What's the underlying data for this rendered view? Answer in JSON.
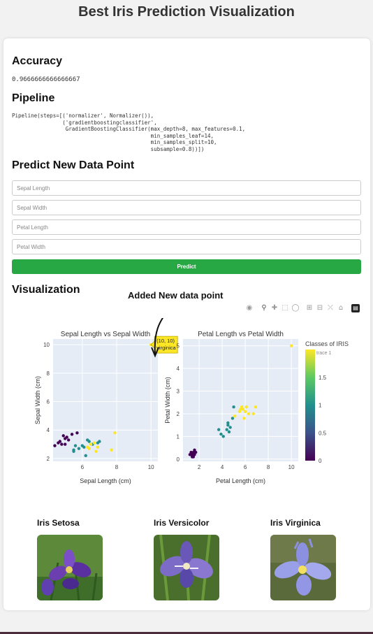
{
  "page_title": "Best Iris Prediction Visualization",
  "accuracy": {
    "heading": "Accuracy",
    "value": "0.9666666666666667"
  },
  "pipeline": {
    "heading": "Pipeline",
    "text": "Pipeline(steps=[('normalizer', Normalizer()),\n                ('gradientboostingclassifier',\n                 GradientBoostingClassifier(max_depth=8, max_features=0.1,\n                                            min_samples_leaf=14,\n                                            min_samples_split=10,\n                                            subsample=0.8))])"
  },
  "predict": {
    "heading": "Predict New Data Point",
    "fields": [
      {
        "placeholder": "Sepal Length"
      },
      {
        "placeholder": "Sepal Width"
      },
      {
        "placeholder": "Petal Length"
      },
      {
        "placeholder": "Petal Width"
      }
    ],
    "button_label": "Predict"
  },
  "visualization": {
    "heading": "Visualization",
    "annotation": "Added New data point",
    "modebar_icons": [
      "camera-icon",
      "zoom-icon",
      "pan-icon",
      "box-select-icon",
      "lasso-icon",
      "zoom-in-icon",
      "zoom-out-icon",
      "autoscale-icon",
      "reset-axes-icon",
      "plotly-logo-icon"
    ]
  },
  "chart_data": [
    {
      "type": "scatter",
      "title": "Sepal Length vs Sepal Width",
      "xlabel": "Sepal Length (cm)",
      "ylabel": "Sepal Width (cm)",
      "xlim": [
        4.3,
        10.4
      ],
      "ylim": [
        1.8,
        10.4
      ],
      "xticks": [
        6,
        8,
        10
      ],
      "yticks": [
        2,
        4,
        6,
        8,
        10
      ],
      "grid": true,
      "tooltip": {
        "x": 10,
        "y": 10,
        "lines": [
          "(10, 10)",
          "virginica"
        ]
      },
      "points": [
        {
          "x": 4.6,
          "y": 3.1,
          "c": 0
        },
        {
          "x": 4.7,
          "y": 3.2,
          "c": 0
        },
        {
          "x": 4.8,
          "y": 3.0,
          "c": 0
        },
        {
          "x": 4.9,
          "y": 3.6,
          "c": 0
        },
        {
          "x": 5.0,
          "y": 3.4,
          "c": 0
        },
        {
          "x": 5.1,
          "y": 3.5,
          "c": 0
        },
        {
          "x": 5.2,
          "y": 3.3,
          "c": 0
        },
        {
          "x": 5.4,
          "y": 3.7,
          "c": 0
        },
        {
          "x": 5.0,
          "y": 3.0,
          "c": 0
        },
        {
          "x": 5.7,
          "y": 3.8,
          "c": 0
        },
        {
          "x": 4.4,
          "y": 2.9,
          "c": 0
        },
        {
          "x": 5.5,
          "y": 2.5,
          "c": 1
        },
        {
          "x": 5.6,
          "y": 2.9,
          "c": 1
        },
        {
          "x": 5.8,
          "y": 2.7,
          "c": 1
        },
        {
          "x": 6.0,
          "y": 2.9,
          "c": 1
        },
        {
          "x": 6.1,
          "y": 2.8,
          "c": 1
        },
        {
          "x": 6.2,
          "y": 2.2,
          "c": 1
        },
        {
          "x": 6.4,
          "y": 3.2,
          "c": 1
        },
        {
          "x": 6.6,
          "y": 3.0,
          "c": 1
        },
        {
          "x": 6.9,
          "y": 3.1,
          "c": 1
        },
        {
          "x": 7.0,
          "y": 3.2,
          "c": 1
        },
        {
          "x": 5.5,
          "y": 2.6,
          "c": 1
        },
        {
          "x": 6.3,
          "y": 3.3,
          "c": 1
        },
        {
          "x": 6.3,
          "y": 2.8,
          "c": 2
        },
        {
          "x": 6.5,
          "y": 3.0,
          "c": 2
        },
        {
          "x": 6.7,
          "y": 3.1,
          "c": 2
        },
        {
          "x": 6.9,
          "y": 2.8,
          "c": 2
        },
        {
          "x": 7.7,
          "y": 2.6,
          "c": 2
        },
        {
          "x": 7.9,
          "y": 3.8,
          "c": 2
        },
        {
          "x": 6.8,
          "y": 2.5,
          "c": 2
        },
        {
          "x": 6.4,
          "y": 2.7,
          "c": 2
        },
        {
          "x": 10,
          "y": 10,
          "c": 2
        }
      ]
    },
    {
      "type": "scatter",
      "title": "Petal Length vs Petal Width",
      "xlabel": "Petal Length (cm)",
      "ylabel": "Petal Width (cm)",
      "xlim": [
        0.6,
        10.6
      ],
      "ylim": [
        -0.1,
        5.3
      ],
      "xticks": [
        2,
        4,
        6,
        8,
        10
      ],
      "yticks": [
        0,
        1,
        2,
        3,
        4,
        5
      ],
      "grid": true,
      "points": [
        {
          "x": 1.3,
          "y": 0.2,
          "c": 0
        },
        {
          "x": 1.4,
          "y": 0.2,
          "c": 0
        },
        {
          "x": 1.5,
          "y": 0.3,
          "c": 0
        },
        {
          "x": 1.6,
          "y": 0.4,
          "c": 0
        },
        {
          "x": 1.4,
          "y": 0.1,
          "c": 0
        },
        {
          "x": 1.5,
          "y": 0.1,
          "c": 0
        },
        {
          "x": 1.3,
          "y": 0.3,
          "c": 0
        },
        {
          "x": 1.6,
          "y": 0.2,
          "c": 0
        },
        {
          "x": 1.2,
          "y": 0.2,
          "c": 0
        },
        {
          "x": 1.7,
          "y": 0.3,
          "c": 0
        },
        {
          "x": 3.9,
          "y": 1.1,
          "c": 1
        },
        {
          "x": 3.7,
          "y": 1.3,
          "c": 1
        },
        {
          "x": 4.5,
          "y": 1.5,
          "c": 1
        },
        {
          "x": 4.7,
          "y": 1.4,
          "c": 1
        },
        {
          "x": 4.4,
          "y": 1.3,
          "c": 1
        },
        {
          "x": 4.1,
          "y": 1.0,
          "c": 1
        },
        {
          "x": 4.6,
          "y": 1.2,
          "c": 1
        },
        {
          "x": 4.5,
          "y": 1.6,
          "c": 1
        },
        {
          "x": 4.9,
          "y": 1.8,
          "c": 1
        },
        {
          "x": 5.0,
          "y": 2.3,
          "c": 1
        },
        {
          "x": 5.1,
          "y": 1.9,
          "c": 2
        },
        {
          "x": 5.6,
          "y": 2.2,
          "c": 2
        },
        {
          "x": 5.8,
          "y": 2.2,
          "c": 2
        },
        {
          "x": 6.1,
          "y": 2.3,
          "c": 2
        },
        {
          "x": 5.5,
          "y": 2.1,
          "c": 2
        },
        {
          "x": 6.0,
          "y": 2.1,
          "c": 2
        },
        {
          "x": 6.7,
          "y": 2.0,
          "c": 2
        },
        {
          "x": 5.7,
          "y": 2.3,
          "c": 2
        },
        {
          "x": 6.9,
          "y": 2.3,
          "c": 2
        },
        {
          "x": 5.9,
          "y": 1.8,
          "c": 2
        },
        {
          "x": 6.3,
          "y": 2.0,
          "c": 2
        },
        {
          "x": 10,
          "y": 5,
          "c": 2
        }
      ]
    }
  ],
  "colorbar": {
    "title": "Classes of IRIS",
    "trace_label": "trace 1",
    "range": [
      0,
      2
    ],
    "ticks": [
      "0",
      "0.5",
      "1",
      "1.5"
    ]
  },
  "colors": {
    "class0": "#440154",
    "class1": "#21908d",
    "class2": "#fde725",
    "plot_bg": "#e5ecf6",
    "button": "#28a745"
  },
  "flowers": [
    {
      "name": "Iris Setosa"
    },
    {
      "name": "Iris Versicolor"
    },
    {
      "name": "Iris Virginica"
    }
  ]
}
